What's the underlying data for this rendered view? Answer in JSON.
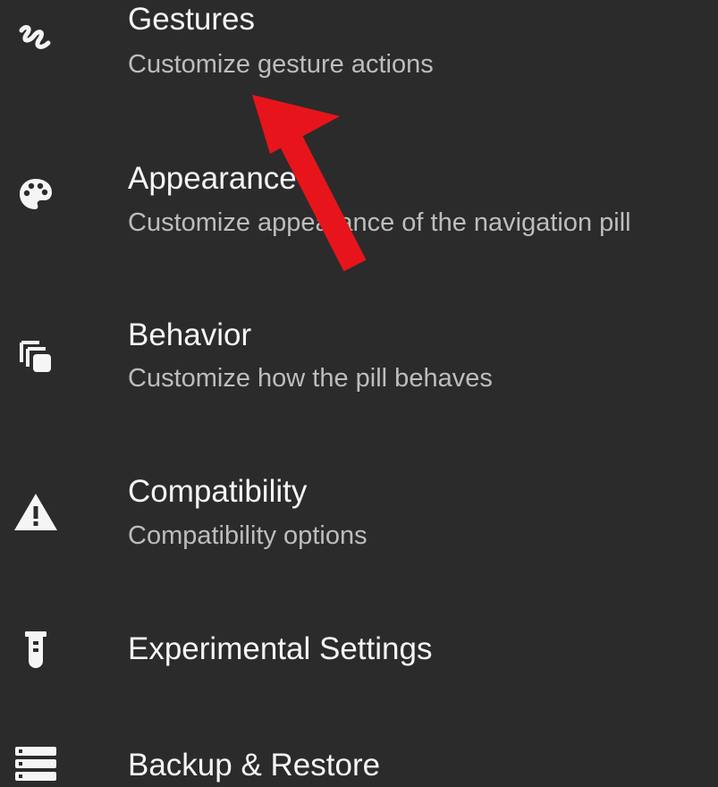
{
  "settings": {
    "items": [
      {
        "icon": "gesture-icon",
        "title": "Gestures",
        "subtitle": "Customize gesture actions"
      },
      {
        "icon": "palette-icon",
        "title": "Appearance",
        "subtitle": "Customize appearance of the navigation pill"
      },
      {
        "icon": "layers-icon",
        "title": "Behavior",
        "subtitle": "Customize how the pill behaves"
      },
      {
        "icon": "warning-icon",
        "title": "Compatibility",
        "subtitle": "Compatibility options"
      },
      {
        "icon": "flask-icon",
        "title": "Experimental Settings"
      },
      {
        "icon": "backup-icon",
        "title": "Backup & Restore"
      }
    ]
  },
  "colors": {
    "background": "#2b2b2b",
    "title_text": "#f5f5f5",
    "subtitle_text": "#bdbdbd",
    "annotation_arrow": "#e8141b"
  }
}
